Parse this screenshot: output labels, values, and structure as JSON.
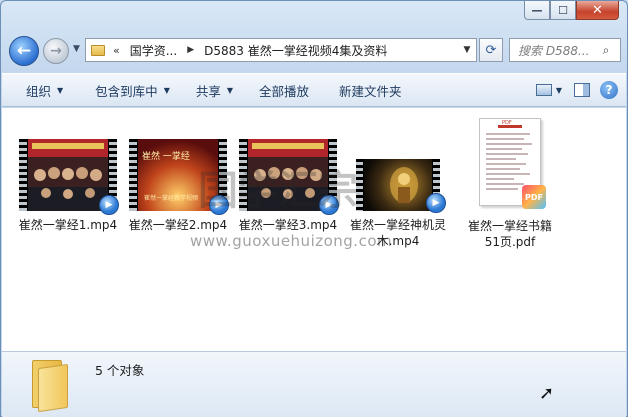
{
  "window": {
    "caption_buttons": {
      "minimize": "—",
      "maximize": "☐",
      "close": "✕"
    }
  },
  "nav": {
    "back_glyph": "←",
    "forward_glyph": "→",
    "history_dropdown": "▼",
    "address": {
      "chevron": "«",
      "crumbs": [
        "国学资...",
        "D5883 崔然一掌经视频4集及资料"
      ],
      "separator": "▶",
      "dropdown": "▼"
    },
    "refresh_glyph": "⟳",
    "search_placeholder": "搜索 D588...",
    "search_icon": "⌕"
  },
  "toolbar": {
    "items": [
      {
        "label": "组织",
        "has_arrow": true,
        "arrow": "▼"
      },
      {
        "label": "包含到库中",
        "has_arrow": true,
        "arrow": "▼"
      },
      {
        "label": "共享",
        "has_arrow": true,
        "arrow": "▼"
      },
      {
        "label": "全部播放",
        "has_arrow": false,
        "arrow": ""
      },
      {
        "label": "新建文件夹",
        "has_arrow": false,
        "arrow": ""
      }
    ],
    "view_arrow": "▼",
    "help_glyph": "?"
  },
  "files": [
    {
      "name": "崔然一掌经1.mp4",
      "type": "video"
    },
    {
      "name": "崔然一掌经2.mp4",
      "type": "video"
    },
    {
      "name": "崔然一掌经3.mp4",
      "type": "video"
    },
    {
      "name": "崔然一掌经神机灵木.mp4",
      "type": "video"
    },
    {
      "name": "崔然一掌经书籍51页.pdf",
      "type": "pdf"
    }
  ],
  "thumb_text": {
    "video2_title": "崔然 一掌经",
    "video2_caption": "崔然一掌经教学视频",
    "pdf_header": "PDF",
    "pdf_badge": "PDF"
  },
  "watermark": {
    "url": "www.guoxuehuizong.com",
    "big": "国学汇宗"
  },
  "details": {
    "count_text": "5 个对象"
  },
  "colors": {
    "window_frame": "#c3d7ee",
    "toolbar_text": "#1e3a5f",
    "close_button": "#c7432b",
    "play_badge": "#2b78d4"
  }
}
